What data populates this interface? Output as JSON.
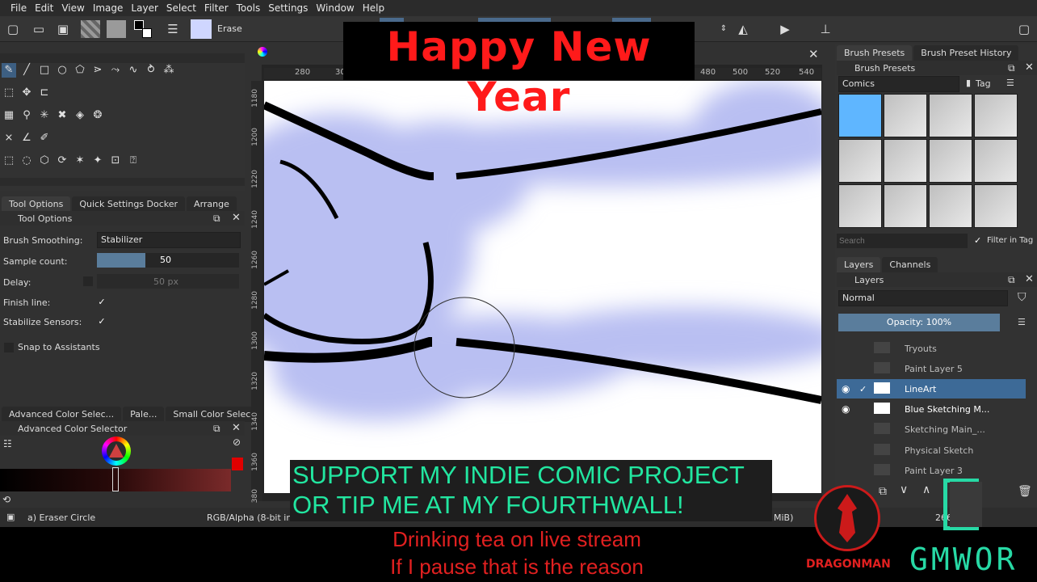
{
  "menu": [
    "File",
    "Edit",
    "View",
    "Image",
    "Layer",
    "Select",
    "Filter",
    "Tools",
    "Settings",
    "Window",
    "Help"
  ],
  "toolbar": {
    "blend_mode": "Erase"
  },
  "ruler": {
    "top": [
      "280",
      "30",
      "480",
      "500",
      "520",
      "540"
    ],
    "left": [
      "1180",
      "1200",
      "1220",
      "1240",
      "1260",
      "1280",
      "1300",
      "1320",
      "1340",
      "1360",
      "380"
    ]
  },
  "left_tabs": [
    "Tool Options",
    "Quick Settings Docker",
    "Arrange"
  ],
  "tool_options": {
    "title": "Tool Options",
    "smoothing_label": "Brush Smoothing:",
    "smoothing_value": "Stabilizer",
    "sample_label": "Sample count:",
    "sample_value": "50",
    "delay_label": "Delay:",
    "delay_value": "50 px",
    "finish_label": "Finish line:",
    "stabilize_label": "Stabilize Sensors:",
    "snap_label": "Snap to Assistants",
    "check": "✓"
  },
  "color_tabs": [
    "Advanced Color Selec...",
    "Pale...",
    "Small Color Selec..."
  ],
  "color_panel_title": "Advanced Color Selector",
  "right_tabs": [
    "Brush Presets",
    "Brush Preset History"
  ],
  "brush_presets": {
    "title": "Brush Presets",
    "tag_combo": "Comics",
    "tag_label": "Tag",
    "search_placeholder": "Search",
    "filter_label": "Filter in Tag"
  },
  "layer_tabs": [
    "Layers",
    "Channels"
  ],
  "layers_panel": {
    "title": "Layers",
    "blend": "Normal",
    "opacity": "Opacity: 100%",
    "layers": [
      "Tryouts",
      "Paint Layer 5",
      "LineArt",
      "Blue Sketching M...",
      "Sketching Main_...",
      "Physical Sketch",
      "Paint Layer 3"
    ],
    "selected_index": 2
  },
  "status": {
    "tool": "a) Eraser Circle",
    "color_space": "RGB/Alpha (8-bit inte",
    "memory": "MiB)",
    "zoom": "266.7"
  },
  "overlays": {
    "banner": "Happy New Year",
    "support_line1": "SUPPORT MY INDIE COMIC PROJECT",
    "support_line2": "OR TIP ME AT MY FOURTHWALL!",
    "tea_line1": "Drinking tea on live stream",
    "tea_line2": "If I pause that is the reason",
    "logo_text": "DRAGONMAN",
    "channel_logo": "GMWOR"
  },
  "colors": {
    "banner_text": "#ff1a1a",
    "support_text": "#22e6a0",
    "tea_text": "#e02020",
    "sketch_blue": "#b9bff2",
    "selection": "#3d6a97"
  }
}
